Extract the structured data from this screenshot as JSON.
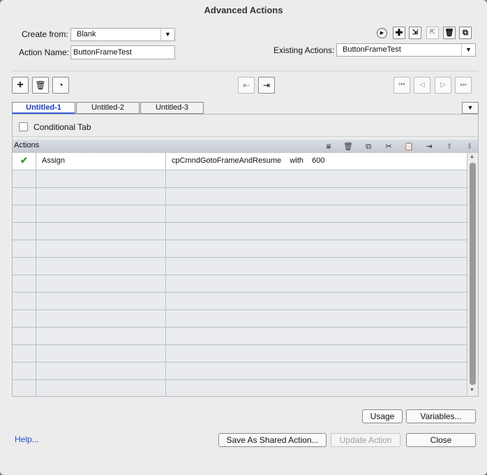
{
  "window": {
    "title": "Advanced Actions"
  },
  "form": {
    "create_from_label": "Create from:",
    "create_from_value": "Blank",
    "action_name_label": "Action Name:",
    "action_name_value": "ButtonFrameTest",
    "existing_actions_label": "Existing Actions:",
    "existing_actions_value": "ButtonFrameTest"
  },
  "tabs": [
    {
      "label": "Untitled-1",
      "active": true
    },
    {
      "label": "Untitled-2",
      "active": false
    },
    {
      "label": "Untitled-3",
      "active": false
    }
  ],
  "conditional": {
    "label": "Conditional Tab",
    "checked": false
  },
  "actions": {
    "header": "Actions",
    "rows": [
      {
        "status": "check-icon",
        "action": "Assign",
        "detail": "cpCmndGotoFrameAndResume    with    600"
      }
    ],
    "empty_rows": 13
  },
  "buttons": {
    "usage": "Usage",
    "variables": "Variables...",
    "help": "Help...",
    "save_shared": "Save As Shared Action...",
    "update": "Update Action",
    "close": "Close"
  },
  "colors": {
    "accent": "#1a3bbf",
    "link": "#1f4fc7",
    "check": "#2e9c1f"
  }
}
